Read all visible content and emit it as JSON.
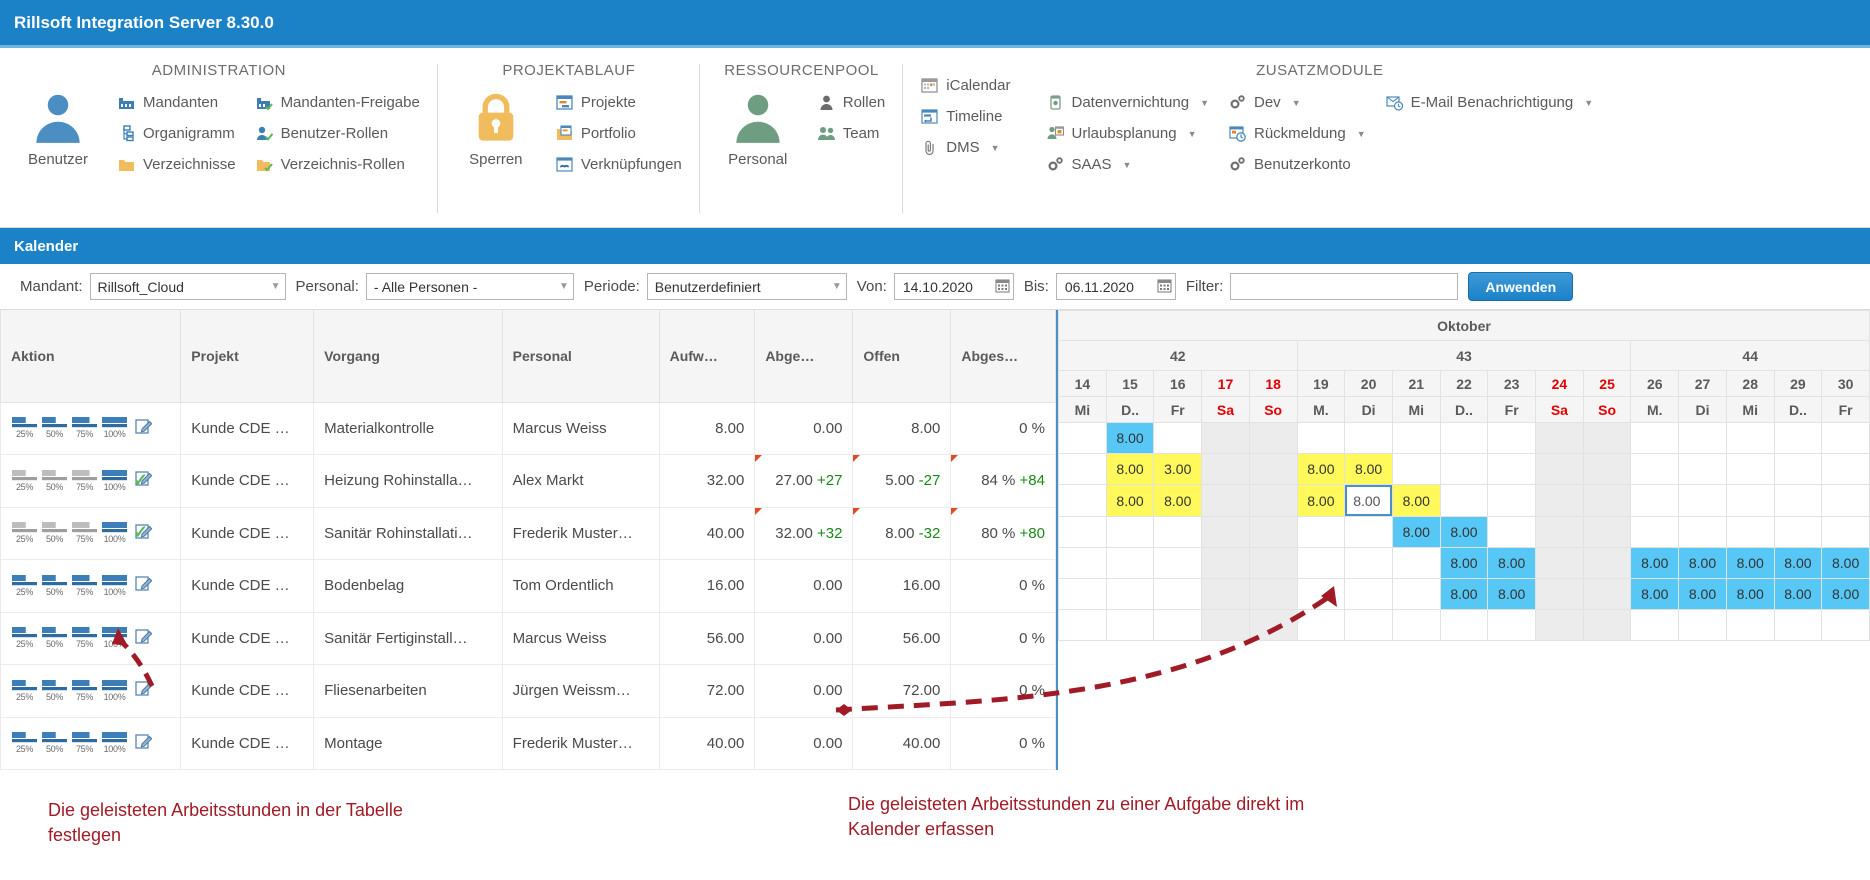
{
  "window": {
    "title": "Rillsoft Integration Server 8.30.0"
  },
  "ribbon": {
    "groups": [
      {
        "title": "ADMINISTRATION",
        "big": {
          "label": "Benutzer",
          "icon": "user-icon"
        },
        "columns": [
          [
            {
              "label": "Mandanten",
              "icon": "factory-icon"
            },
            {
              "label": "Organigramm",
              "icon": "orgchart-icon"
            },
            {
              "label": "Verzeichnisse",
              "icon": "folder-icon"
            }
          ],
          [
            {
              "label": "Mandanten-Freigabe",
              "icon": "factory-check-icon"
            },
            {
              "label": "Benutzer-Rollen",
              "icon": "user-check-icon"
            },
            {
              "label": "Verzeichnis-Rollen",
              "icon": "folder-check-icon"
            }
          ]
        ]
      },
      {
        "title": "PROJEKTABLAUF",
        "big": {
          "label": "Sperren",
          "icon": "lock-icon"
        },
        "columns": [
          [
            {
              "label": "Projekte",
              "icon": "project-icon"
            },
            {
              "label": "Portfolio",
              "icon": "portfolio-icon"
            },
            {
              "label": "Verknüpfungen",
              "icon": "link-icon"
            }
          ]
        ]
      },
      {
        "title": "RESSOURCENPOOL",
        "big": {
          "label": "Personal",
          "icon": "person-icon"
        },
        "columns": [
          [
            {
              "label": "Rollen",
              "icon": "role-icon"
            },
            {
              "label": "Team",
              "icon": "team-icon"
            }
          ]
        ]
      },
      {
        "title": "",
        "columns": [
          [
            {
              "label": "iCalendar",
              "icon": "calendar-icon"
            },
            {
              "label": "Timeline",
              "icon": "timeline-icon"
            },
            {
              "label": "DMS",
              "icon": "clip-icon",
              "caret": true
            }
          ]
        ]
      },
      {
        "title": "ZUSATZMODULE",
        "columns": [
          [
            {
              "label": "Datenvernichtung",
              "icon": "trash-icon",
              "caret": true
            },
            {
              "label": "Urlaubsplanung",
              "icon": "vacation-icon",
              "caret": true
            },
            {
              "label": "SAAS",
              "icon": "gear-icon",
              "caret": true
            }
          ],
          [
            {
              "label": "Dev",
              "icon": "gear-icon",
              "caret": true
            },
            {
              "label": "Rückmeldung",
              "icon": "feedback-icon",
              "caret": true
            },
            {
              "label": "Benutzerkonto",
              "icon": "gear-icon"
            }
          ],
          [
            {
              "label": "E-Mail Benachrichtigung",
              "icon": "mail-clock-icon",
              "caret": true
            }
          ]
        ]
      }
    ]
  },
  "section": {
    "title": "Kalender"
  },
  "filters": {
    "mandant_label": "Mandant:",
    "mandant_value": "Rillsoft_Cloud",
    "personal_label": "Personal:",
    "personal_value": "- Alle Personen -",
    "periode_label": "Periode:",
    "periode_value": "Benutzerdefiniert",
    "von_label": "Von:",
    "von_value": "14.10.2020",
    "bis_label": "Bis:",
    "bis_value": "06.11.2020",
    "filter_label": "Filter:",
    "filter_value": "",
    "filter_placeholder": "",
    "apply_label": "Anwenden"
  },
  "table": {
    "headers": [
      "Aktion",
      "Projekt",
      "Vorgang",
      "Personal",
      "Aufw…",
      "Abge…",
      "Offen",
      "Abges…"
    ],
    "pct_labels": [
      "25%",
      "50%",
      "75%",
      "100%"
    ],
    "rows": [
      {
        "pct_state": [
          true,
          true,
          true,
          true
        ],
        "check": false,
        "projekt": "Kunde CDE …",
        "vorgang": "Materialkontrolle",
        "personal": "Marcus Weiss",
        "aufwand": "8.00",
        "abgeleistet": "0.00",
        "abgeleistet_delta": "",
        "offen": "8.00",
        "offen_delta": "",
        "abgeschlossen": "0 %",
        "abgeschlossen_delta": "",
        "marked": false
      },
      {
        "pct_state": [
          false,
          false,
          false,
          true
        ],
        "check": true,
        "projekt": "Kunde CDE …",
        "vorgang": "Heizung Rohinstalla…",
        "personal": "Alex Markt",
        "aufwand": "32.00",
        "abgeleistet": "27.00",
        "abgeleistet_delta": "+27",
        "offen": "5.00",
        "offen_delta": "-27",
        "abgeschlossen": "84 %",
        "abgeschlossen_delta": "+84",
        "marked": true
      },
      {
        "pct_state": [
          false,
          false,
          false,
          true
        ],
        "check": true,
        "projekt": "Kunde CDE …",
        "vorgang": "Sanitär Rohinstallati…",
        "personal": "Frederik Muster…",
        "aufwand": "40.00",
        "abgeleistet": "32.00",
        "abgeleistet_delta": "+32",
        "offen": "8.00",
        "offen_delta": "-32",
        "abgeschlossen": "80 %",
        "abgeschlossen_delta": "+80",
        "marked": true
      },
      {
        "pct_state": [
          true,
          true,
          true,
          true
        ],
        "check": false,
        "projekt": "Kunde CDE …",
        "vorgang": "Bodenbelag",
        "personal": "Tom Ordentlich",
        "aufwand": "16.00",
        "abgeleistet": "0.00",
        "abgeleistet_delta": "",
        "offen": "16.00",
        "offen_delta": "",
        "abgeschlossen": "0 %",
        "abgeschlossen_delta": "",
        "marked": false
      },
      {
        "pct_state": [
          true,
          true,
          true,
          true
        ],
        "check": false,
        "projekt": "Kunde CDE …",
        "vorgang": "Sanitär Fertiginstall…",
        "personal": "Marcus Weiss",
        "aufwand": "56.00",
        "abgeleistet": "0.00",
        "abgeleistet_delta": "",
        "offen": "56.00",
        "offen_delta": "",
        "abgeschlossen": "0 %",
        "abgeschlossen_delta": "",
        "marked": false
      },
      {
        "pct_state": [
          true,
          true,
          true,
          true
        ],
        "check": false,
        "projekt": "Kunde CDE …",
        "vorgang": "Fliesenarbeiten",
        "personal": "Jürgen Weissm…",
        "aufwand": "72.00",
        "abgeleistet": "0.00",
        "abgeleistet_delta": "",
        "offen": "72.00",
        "offen_delta": "",
        "abgeschlossen": "0 %",
        "abgeschlossen_delta": "",
        "marked": false
      },
      {
        "pct_state": [
          true,
          true,
          true,
          true
        ],
        "check": false,
        "projekt": "Kunde CDE …",
        "vorgang": "Montage",
        "personal": "Frederik Muster…",
        "aufwand": "40.00",
        "abgeleistet": "0.00",
        "abgeleistet_delta": "",
        "offen": "40.00",
        "offen_delta": "",
        "abgeschlossen": "0 %",
        "abgeschlossen_delta": "",
        "marked": false
      }
    ]
  },
  "calendar": {
    "month_label": "Oktober",
    "weeks": [
      {
        "label": "42",
        "span": 5
      },
      {
        "label": "43",
        "span": 7
      },
      {
        "label": "44",
        "span": 5
      }
    ],
    "days": [
      {
        "num": "14",
        "dow": "Mi",
        "weekend": false
      },
      {
        "num": "15",
        "dow": "D..",
        "weekend": false
      },
      {
        "num": "16",
        "dow": "Fr",
        "weekend": false
      },
      {
        "num": "17",
        "dow": "Sa",
        "weekend": true
      },
      {
        "num": "18",
        "dow": "So",
        "weekend": true
      },
      {
        "num": "19",
        "dow": "M.",
        "weekend": false
      },
      {
        "num": "20",
        "dow": "Di",
        "weekend": false
      },
      {
        "num": "21",
        "dow": "Mi",
        "weekend": false
      },
      {
        "num": "22",
        "dow": "D..",
        "weekend": false
      },
      {
        "num": "23",
        "dow": "Fr",
        "weekend": false
      },
      {
        "num": "24",
        "dow": "Sa",
        "weekend": true
      },
      {
        "num": "25",
        "dow": "So",
        "weekend": true
      },
      {
        "num": "26",
        "dow": "M.",
        "weekend": false
      },
      {
        "num": "27",
        "dow": "Di",
        "weekend": false
      },
      {
        "num": "28",
        "dow": "Mi",
        "weekend": false
      },
      {
        "num": "29",
        "dow": "D..",
        "weekend": false
      },
      {
        "num": "30",
        "dow": "Fr",
        "weekend": false
      }
    ],
    "cells": [
      [
        {
          "v": ""
        },
        {
          "v": "8.00",
          "s": "blue"
        },
        {
          "v": ""
        },
        {
          "v": "",
          "s": "we"
        },
        {
          "v": "",
          "s": "we"
        },
        {
          "v": ""
        },
        {
          "v": ""
        },
        {
          "v": ""
        },
        {
          "v": ""
        },
        {
          "v": ""
        },
        {
          "v": "",
          "s": "we"
        },
        {
          "v": "",
          "s": "we"
        },
        {
          "v": ""
        },
        {
          "v": ""
        },
        {
          "v": ""
        },
        {
          "v": ""
        },
        {
          "v": ""
        }
      ],
      [
        {
          "v": ""
        },
        {
          "v": "8.00",
          "s": "yellow"
        },
        {
          "v": "3.00",
          "s": "yellow"
        },
        {
          "v": "",
          "s": "we"
        },
        {
          "v": "",
          "s": "we"
        },
        {
          "v": "8.00",
          "s": "yellow"
        },
        {
          "v": "8.00",
          "s": "yellow"
        },
        {
          "v": ""
        },
        {
          "v": ""
        },
        {
          "v": ""
        },
        {
          "v": "",
          "s": "we"
        },
        {
          "v": "",
          "s": "we"
        },
        {
          "v": ""
        },
        {
          "v": ""
        },
        {
          "v": ""
        },
        {
          "v": ""
        },
        {
          "v": ""
        }
      ],
      [
        {
          "v": ""
        },
        {
          "v": "8.00",
          "s": "yellow"
        },
        {
          "v": "8.00",
          "s": "yellow"
        },
        {
          "v": "",
          "s": "we"
        },
        {
          "v": "",
          "s": "we"
        },
        {
          "v": "8.00",
          "s": "yellow"
        },
        {
          "v": "8.00",
          "s": "sel"
        },
        {
          "v": "8.00",
          "s": "yellow"
        },
        {
          "v": ""
        },
        {
          "v": ""
        },
        {
          "v": "",
          "s": "we"
        },
        {
          "v": "",
          "s": "we"
        },
        {
          "v": ""
        },
        {
          "v": ""
        },
        {
          "v": ""
        },
        {
          "v": ""
        },
        {
          "v": ""
        }
      ],
      [
        {
          "v": ""
        },
        {
          "v": ""
        },
        {
          "v": ""
        },
        {
          "v": "",
          "s": "we"
        },
        {
          "v": "",
          "s": "we"
        },
        {
          "v": ""
        },
        {
          "v": ""
        },
        {
          "v": "8.00",
          "s": "blue"
        },
        {
          "v": "8.00",
          "s": "blue"
        },
        {
          "v": ""
        },
        {
          "v": "",
          "s": "we"
        },
        {
          "v": "",
          "s": "we"
        },
        {
          "v": ""
        },
        {
          "v": ""
        },
        {
          "v": ""
        },
        {
          "v": ""
        },
        {
          "v": ""
        }
      ],
      [
        {
          "v": ""
        },
        {
          "v": ""
        },
        {
          "v": ""
        },
        {
          "v": "",
          "s": "we"
        },
        {
          "v": "",
          "s": "we"
        },
        {
          "v": ""
        },
        {
          "v": ""
        },
        {
          "v": ""
        },
        {
          "v": "8.00",
          "s": "blue"
        },
        {
          "v": "8.00",
          "s": "blue"
        },
        {
          "v": "",
          "s": "we"
        },
        {
          "v": "",
          "s": "we"
        },
        {
          "v": "8.00",
          "s": "blue"
        },
        {
          "v": "8.00",
          "s": "blue"
        },
        {
          "v": "8.00",
          "s": "blue"
        },
        {
          "v": "8.00",
          "s": "blue"
        },
        {
          "v": "8.00",
          "s": "blue"
        }
      ],
      [
        {
          "v": ""
        },
        {
          "v": ""
        },
        {
          "v": ""
        },
        {
          "v": "",
          "s": "we"
        },
        {
          "v": "",
          "s": "we"
        },
        {
          "v": ""
        },
        {
          "v": ""
        },
        {
          "v": ""
        },
        {
          "v": "8.00",
          "s": "blue"
        },
        {
          "v": "8.00",
          "s": "blue"
        },
        {
          "v": "",
          "s": "we"
        },
        {
          "v": "",
          "s": "we"
        },
        {
          "v": "8.00",
          "s": "blue"
        },
        {
          "v": "8.00",
          "s": "blue"
        },
        {
          "v": "8.00",
          "s": "blue"
        },
        {
          "v": "8.00",
          "s": "blue"
        },
        {
          "v": "8.00",
          "s": "blue"
        }
      ],
      [
        {
          "v": ""
        },
        {
          "v": ""
        },
        {
          "v": ""
        },
        {
          "v": "",
          "s": "we"
        },
        {
          "v": "",
          "s": "we"
        },
        {
          "v": ""
        },
        {
          "v": ""
        },
        {
          "v": ""
        },
        {
          "v": ""
        },
        {
          "v": ""
        },
        {
          "v": "",
          "s": "we"
        },
        {
          "v": "",
          "s": "we"
        },
        {
          "v": ""
        },
        {
          "v": ""
        },
        {
          "v": ""
        },
        {
          "v": ""
        },
        {
          "v": ""
        }
      ]
    ]
  },
  "notes": {
    "left": "Die geleisteten Arbeitsstunden in der Tabelle\nfestlegen",
    "right": "Die geleisteten Arbeitsstunden zu einer Aufgabe direkt im\nKalender erfassen",
    "color": "#a01b26"
  }
}
